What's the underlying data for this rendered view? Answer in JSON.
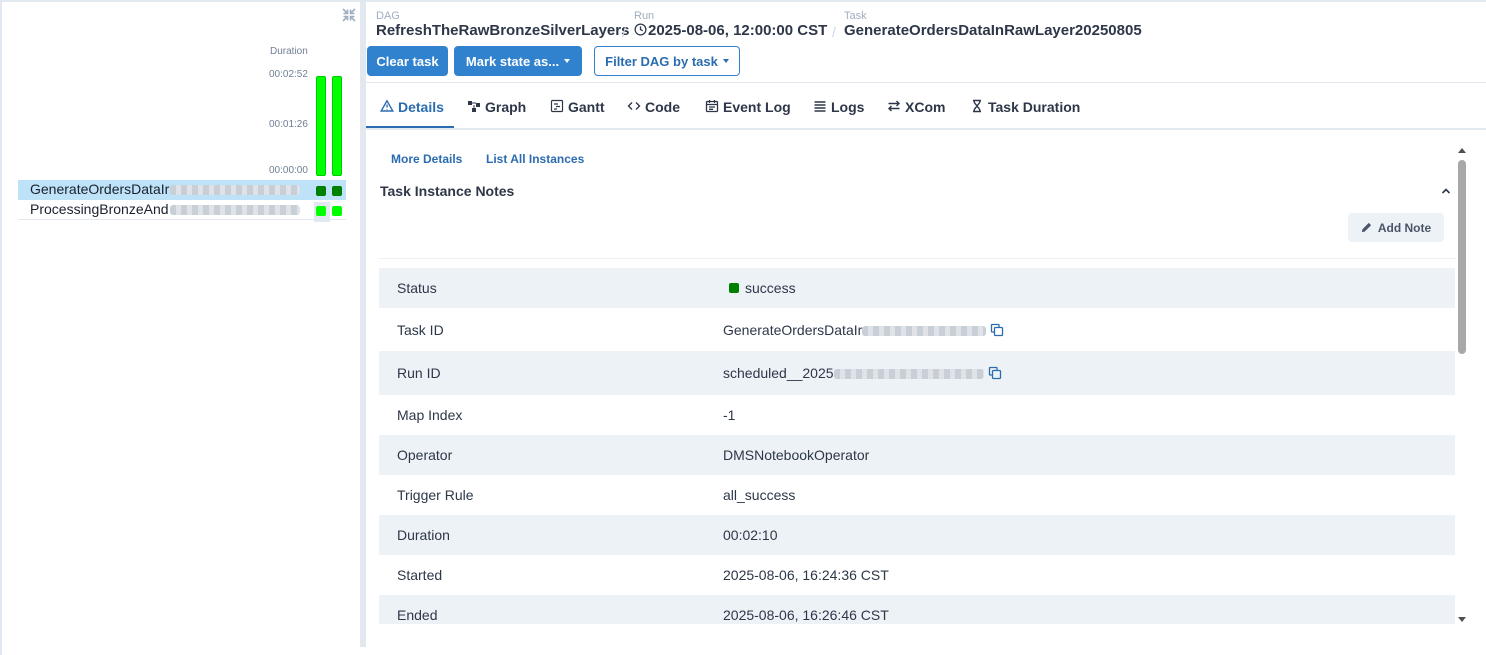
{
  "colors": {
    "success": "#008000",
    "success_light": "#00ff00",
    "accent": "#3182ce",
    "selected_row": "#bee3f8"
  },
  "grid": {
    "duration_label": "Duration",
    "ticks": [
      "00:02:52",
      "00:01:26",
      "00:00:00"
    ],
    "rows": [
      {
        "label": "GenerateOrdersDataIr",
        "state": "success"
      },
      {
        "label": "ProcessingBronzeAnd",
        "state": "success"
      }
    ]
  },
  "breadcrumb": {
    "dag_label": "DAG",
    "dag_value": "RefreshTheRawBronzeSilverLayers",
    "run_label": "Run",
    "run_value": "2025-08-06, 12:00:00 CST",
    "task_label": "Task",
    "task_value": "GenerateOrdersDataInRawLayer20250805",
    "separator": "/"
  },
  "actions": {
    "clear_task": "Clear task",
    "mark_state": "Mark state as...",
    "filter_dag": "Filter DAG by task"
  },
  "tabs": [
    {
      "label": "Details",
      "icon": "warning-triangle-icon"
    },
    {
      "label": "Graph",
      "icon": "graph-icon"
    },
    {
      "label": "Gantt",
      "icon": "gantt-icon"
    },
    {
      "label": "Code",
      "icon": "code-icon"
    },
    {
      "label": "Event Log",
      "icon": "calendar-icon"
    },
    {
      "label": "Logs",
      "icon": "list-icon"
    },
    {
      "label": "XCom",
      "icon": "arrows-icon"
    },
    {
      "label": "Task Duration",
      "icon": "hourglass-icon"
    }
  ],
  "details": {
    "more_details": "More Details",
    "list_all_instances": "List All Instances",
    "notes_title": "Task Instance Notes",
    "add_note": "Add Note",
    "rows": [
      {
        "key": "Status",
        "value": "success"
      },
      {
        "key": "Task ID",
        "value": "GenerateOrdersDataIr"
      },
      {
        "key": "Run ID",
        "value": "scheduled__2025"
      },
      {
        "key": "Map Index",
        "value": "-1"
      },
      {
        "key": "Operator",
        "value": "DMSNotebookOperator"
      },
      {
        "key": "Trigger Rule",
        "value": "all_success"
      },
      {
        "key": "Duration",
        "value": "00:02:10"
      },
      {
        "key": "Started",
        "value": "2025-08-06, 16:24:36 CST"
      },
      {
        "key": "Ended",
        "value": "2025-08-06, 16:26:46 CST"
      }
    ]
  }
}
